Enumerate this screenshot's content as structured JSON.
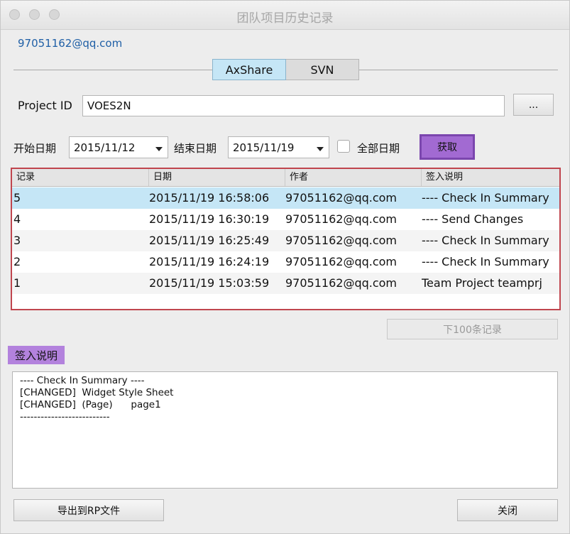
{
  "window": {
    "title": "团队项目历史记录"
  },
  "account": "97051162@qq.com",
  "tabs": [
    {
      "label": "AxShare",
      "active": true
    },
    {
      "label": "SVN",
      "active": false
    }
  ],
  "project": {
    "label": "Project ID",
    "value": "VOES2N",
    "browse_label": "..."
  },
  "filters": {
    "start_label": "开始日期",
    "start_value": "2015/11/12",
    "end_label": "结束日期",
    "end_value": "2015/11/19",
    "all_dates_label": "全部日期",
    "all_dates_checked": false,
    "fetch_label": "获取"
  },
  "table": {
    "headers": [
      "记录",
      "日期",
      "作者",
      "签入说明"
    ],
    "rows": [
      {
        "record": "5",
        "date": "2015/11/19 16:58:06",
        "author": "97051162@qq.com",
        "note": "---- Check In Summary",
        "selected": true
      },
      {
        "record": "4",
        "date": "2015/11/19 16:30:19",
        "author": "97051162@qq.com",
        "note": "---- Send Changes",
        "selected": false
      },
      {
        "record": "3",
        "date": "2015/11/19 16:25:49",
        "author": "97051162@qq.com",
        "note": "---- Check In Summary",
        "selected": false
      },
      {
        "record": "2",
        "date": "2015/11/19 16:24:19",
        "author": "97051162@qq.com",
        "note": "---- Check In Summary",
        "selected": false
      },
      {
        "record": "1",
        "date": "2015/11/19 15:03:59",
        "author": "97051162@qq.com",
        "note": "Team Project teamprj",
        "selected": false
      }
    ]
  },
  "next_button": "下100条记录",
  "notes": {
    "label": "签入说明",
    "lines": [
      "---- Check In Summary ----",
      "[CHANGED]  Widget Style Sheet",
      "[CHANGED]  (Page)      page1",
      "--------------------------"
    ]
  },
  "footer": {
    "export_label": "导出到RP文件",
    "close_label": "关闭"
  },
  "colors": {
    "accent_purple": "#a26ad2",
    "selected_row": "#c5e6f6",
    "table_border": "#c0454e",
    "account_link": "#1f5fa6"
  }
}
